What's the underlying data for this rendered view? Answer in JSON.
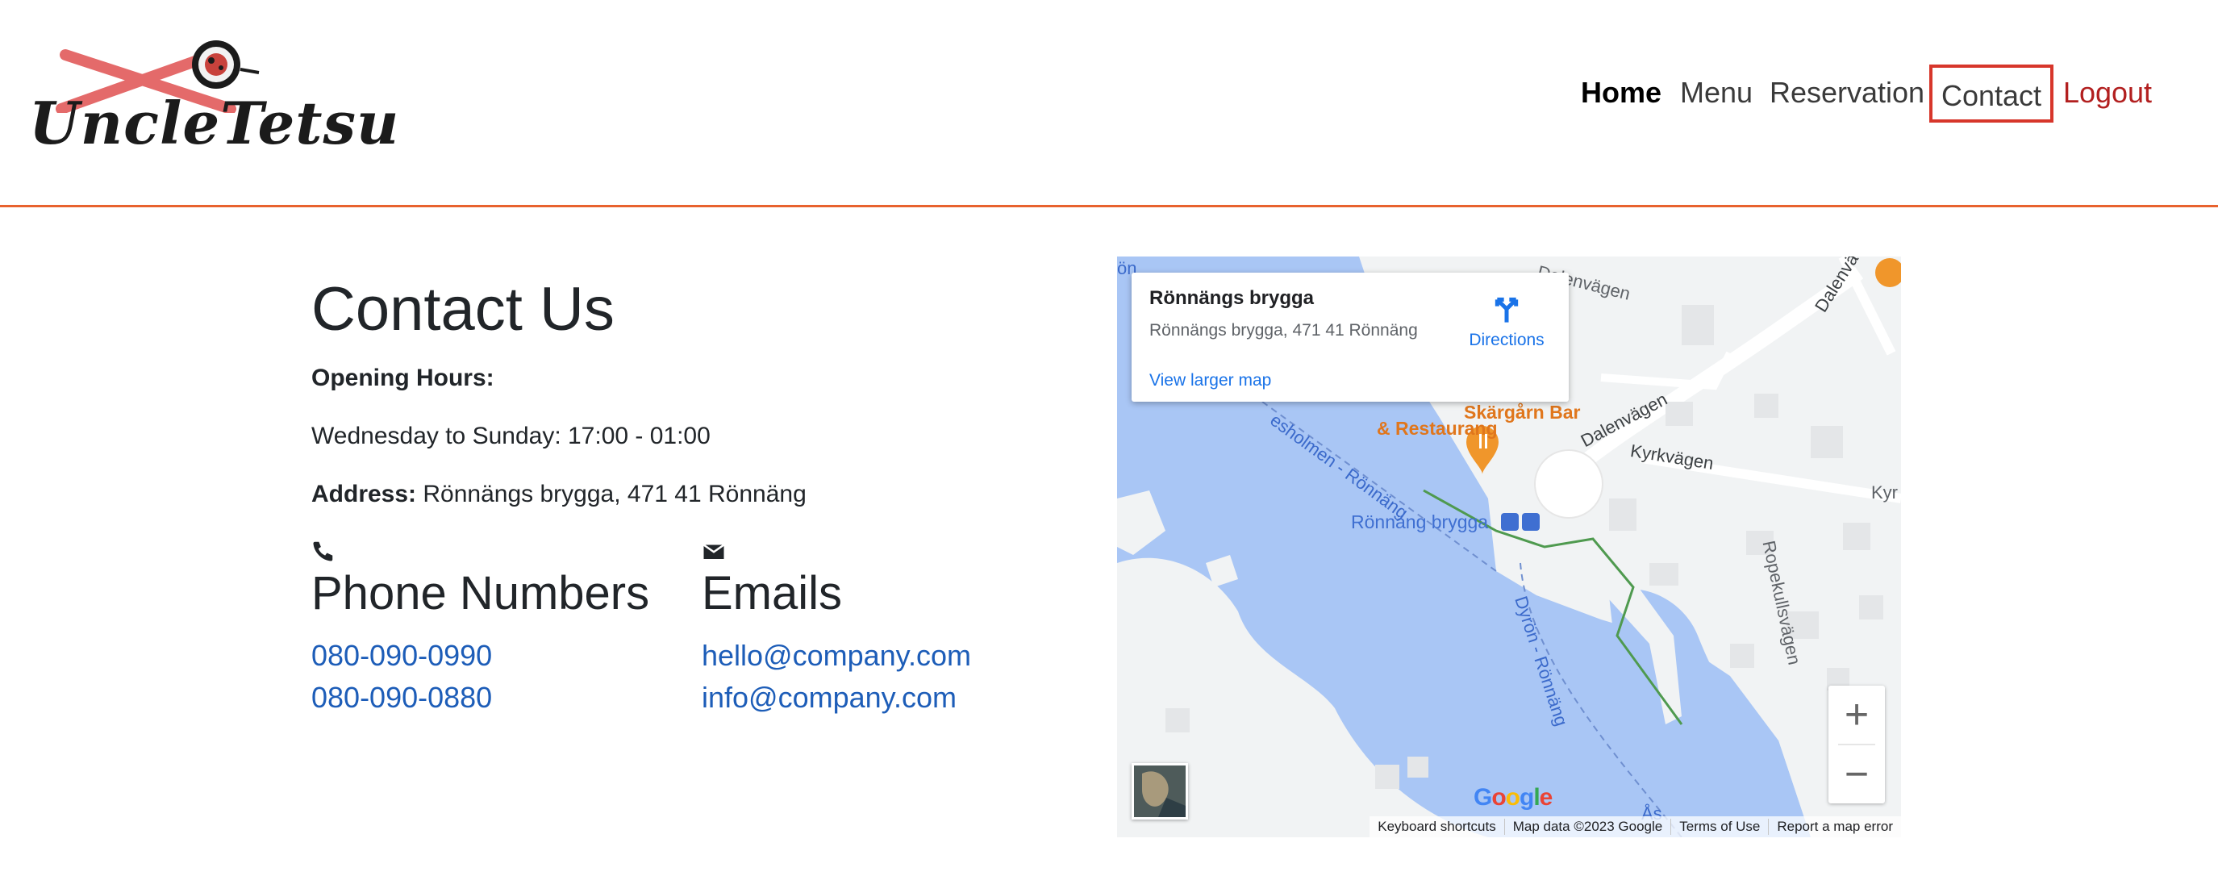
{
  "header": {
    "logo_text": "UncleTetsu",
    "nav": [
      {
        "label": "Home"
      },
      {
        "label": "Menu"
      },
      {
        "label": "Reservation"
      },
      {
        "label": "Contact"
      },
      {
        "label": "Logout"
      }
    ]
  },
  "contact": {
    "title": "Contact Us",
    "hours_label": "Opening Hours:",
    "hours_value": "Wednesday to Sunday: 17:00 - 01:00",
    "address_label": "Address:",
    "address_value": "Rönnängs brygga, 471 41 Rönnäng",
    "phone": {
      "icon": "phone-icon",
      "title": "Phone Numbers",
      "numbers": [
        "080-090-0990",
        "080-090-0880"
      ]
    },
    "email": {
      "icon": "envelope-icon",
      "title": "Emails",
      "addresses": [
        "hello@company.com",
        "info@company.com"
      ]
    }
  },
  "map": {
    "place_name": "Rönnängs brygga",
    "place_address": "Rönnängs brygga, 471 41 Rönnäng",
    "directions_label": "Directions",
    "view_larger": "View larger map",
    "labels": {
      "restaurant_1": "Skärgårn Bar",
      "restaurant_2": "& Restaurang",
      "stop": "Rönnäng brygga",
      "road_1": "Dalenvägen",
      "road_2": "Dalenvägen",
      "road_3": "Kyrkvägen",
      "road_4": "Ropekullsvägen",
      "road_5": "Dalenvä",
      "road_6": "Kyr",
      "ferry_1": "esholmen - Rönnäng",
      "ferry_2": "Dyrön - Rönnäng",
      "ferry_3": "Ås",
      "edge_1": "ön"
    },
    "zoom_in": "+",
    "zoom_out": "−",
    "google": [
      "G",
      "o",
      "o",
      "g",
      "l",
      "e"
    ],
    "footer": [
      "Keyboard shortcuts",
      "Map data ©2023 Google",
      "Terms of Use",
      "Report a map error"
    ],
    "colors": {
      "water": "#a9c6f5",
      "land": "#f1f3f4",
      "link": "#1a73e8",
      "poi": "#f0962b"
    }
  },
  "colors": {
    "accent": "#e8622e",
    "logout": "#b21f1f",
    "link": "#1d5db8"
  }
}
